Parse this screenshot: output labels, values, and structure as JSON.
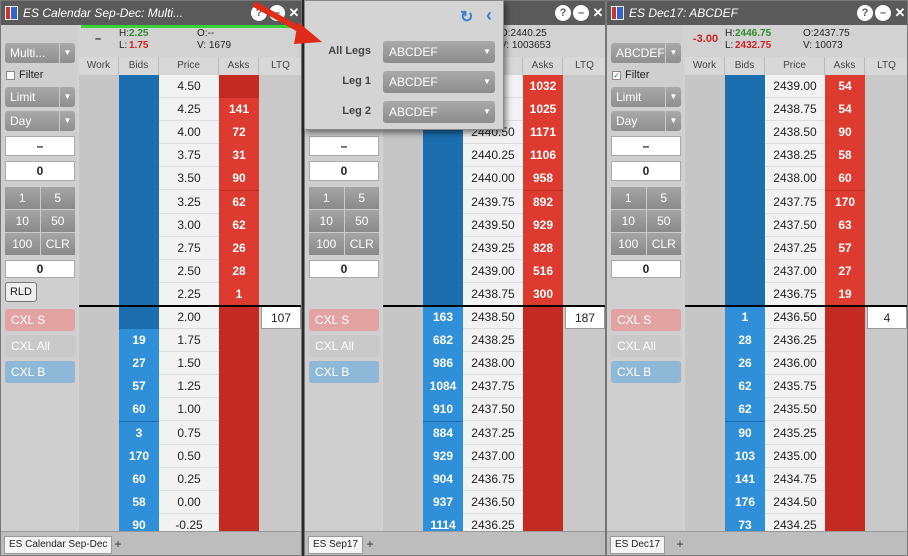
{
  "windows": [
    {
      "title": "ES Calendar Sep-Dec: Multi...",
      "header": {
        "net": "–",
        "high_label": "H:",
        "high": "2.25",
        "low_label": "L:",
        "low": "1.75",
        "open": "O:--",
        "volume": "V: 1679"
      },
      "side": {
        "account": "Multi...",
        "filter": "Filter",
        "filter_checked": false,
        "order_type": "Limit",
        "tif": "Day",
        "price": "–",
        "qty": "0",
        "qty_buttons": [
          "1",
          "5",
          "10",
          "50",
          "100",
          "CLR"
        ],
        "pos": "0",
        "rld": "RLD",
        "cxl_s": "CXL S",
        "cxl_all": "CXL All",
        "cxl_b": "CXL B"
      },
      "columns": [
        "Work",
        "Bids",
        "Price",
        "Asks",
        "LTQ"
      ],
      "rows": [
        {
          "bid": "",
          "price": "4.50",
          "ask": ""
        },
        {
          "bid": "",
          "price": "4.25",
          "ask": "141"
        },
        {
          "bid": "",
          "price": "4.00",
          "ask": "72"
        },
        {
          "bid": "",
          "price": "3.75",
          "ask": "31"
        },
        {
          "bid": "",
          "price": "3.50",
          "ask": "90"
        },
        {
          "bid": "",
          "price": "3.25",
          "ask": "62"
        },
        {
          "bid": "",
          "price": "3.00",
          "ask": "62"
        },
        {
          "bid": "",
          "price": "2.75",
          "ask": "26"
        },
        {
          "bid": "",
          "price": "2.50",
          "ask": "28"
        },
        {
          "bid": "",
          "price": "2.25",
          "ask": "1"
        },
        {
          "bid": "",
          "price": "2.00",
          "ask": "",
          "ltq": "107"
        },
        {
          "bid": "19",
          "price": "1.75",
          "ask": ""
        },
        {
          "bid": "27",
          "price": "1.50",
          "ask": ""
        },
        {
          "bid": "57",
          "price": "1.25",
          "ask": ""
        },
        {
          "bid": "60",
          "price": "1.00",
          "ask": ""
        },
        {
          "bid": "3",
          "price": "0.75",
          "ask": ""
        },
        {
          "bid": "170",
          "price": "0.50",
          "ask": ""
        },
        {
          "bid": "60",
          "price": "0.25",
          "ask": ""
        },
        {
          "bid": "58",
          "price": "0.00",
          "ask": ""
        },
        {
          "bid": "90",
          "price": "-0.25",
          "ask": ""
        }
      ],
      "tab": "ES Calendar Sep-Dec"
    },
    {
      "title": "",
      "header": {
        "net": "",
        "high_label": "",
        "high": "",
        "low_label": "",
        "low": "",
        "open": "O:2440.25",
        "volume": "V: 1003653"
      },
      "side": {
        "account": "",
        "filter": "",
        "filter_checked": false,
        "order_type": "",
        "tif": "",
        "price": "–",
        "qty": "0",
        "qty_buttons": [
          "1",
          "5",
          "10",
          "50",
          "100",
          "CLR"
        ],
        "pos": "0",
        "rld": "",
        "cxl_s": "CXL S",
        "cxl_all": "CXL All",
        "cxl_b": "CXL B"
      },
      "columns": [
        "Work",
        "Bids",
        "Price",
        "Asks",
        "LTQ"
      ],
      "rows": [
        {
          "bid": "",
          "price": "",
          "ask": "1032"
        },
        {
          "bid": "",
          "price": "",
          "ask": "1025"
        },
        {
          "bid": "",
          "price": "2440.50",
          "ask": "1171"
        },
        {
          "bid": "",
          "price": "2440.25",
          "ask": "1106"
        },
        {
          "bid": "",
          "price": "2440.00",
          "ask": "958"
        },
        {
          "bid": "",
          "price": "2439.75",
          "ask": "892"
        },
        {
          "bid": "",
          "price": "2439.50",
          "ask": "929"
        },
        {
          "bid": "",
          "price": "2439.25",
          "ask": "828"
        },
        {
          "bid": "",
          "price": "2439.00",
          "ask": "516"
        },
        {
          "bid": "",
          "price": "2438.75",
          "ask": "300"
        },
        {
          "bid": "163",
          "price": "2438.50",
          "ask": "",
          "ltq": "187"
        },
        {
          "bid": "682",
          "price": "2438.25",
          "ask": ""
        },
        {
          "bid": "986",
          "price": "2438.00",
          "ask": ""
        },
        {
          "bid": "1084",
          "price": "2437.75",
          "ask": ""
        },
        {
          "bid": "910",
          "price": "2437.50",
          "ask": ""
        },
        {
          "bid": "884",
          "price": "2437.25",
          "ask": ""
        },
        {
          "bid": "929",
          "price": "2437.00",
          "ask": ""
        },
        {
          "bid": "904",
          "price": "2436.75",
          "ask": ""
        },
        {
          "bid": "937",
          "price": "2436.50",
          "ask": ""
        },
        {
          "bid": "1114",
          "price": "2436.25",
          "ask": ""
        }
      ],
      "tab": "ES Sep17"
    },
    {
      "title": "ES Dec17: ABCDEF",
      "header": {
        "net": "-3.00",
        "high_label": "H:",
        "high": "2446.75",
        "low_label": "L:",
        "low": "2432.75",
        "open": "O:2437.75",
        "volume": "V: 10073"
      },
      "side": {
        "account": "ABCDEF",
        "filter": "Filter",
        "filter_checked": true,
        "order_type": "Limit",
        "tif": "Day",
        "price": "–",
        "qty": "0",
        "qty_buttons": [
          "1",
          "5",
          "10",
          "50",
          "100",
          "CLR"
        ],
        "pos": "0",
        "rld": "",
        "cxl_s": "CXL S",
        "cxl_all": "CXL All",
        "cxl_b": "CXL B"
      },
      "columns": [
        "Work",
        "Bids",
        "Price",
        "Asks",
        "LTQ"
      ],
      "rows": [
        {
          "bid": "",
          "price": "2439.00",
          "ask": "54"
        },
        {
          "bid": "",
          "price": "2438.75",
          "ask": "54"
        },
        {
          "bid": "",
          "price": "2438.50",
          "ask": "90"
        },
        {
          "bid": "",
          "price": "2438.25",
          "ask": "58"
        },
        {
          "bid": "",
          "price": "2438.00",
          "ask": "60"
        },
        {
          "bid": "",
          "price": "2437.75",
          "ask": "170"
        },
        {
          "bid": "",
          "price": "2437.50",
          "ask": "63"
        },
        {
          "bid": "",
          "price": "2437.25",
          "ask": "57"
        },
        {
          "bid": "",
          "price": "2437.00",
          "ask": "27"
        },
        {
          "bid": "",
          "price": "2436.75",
          "ask": "19"
        },
        {
          "bid": "1",
          "price": "2436.50",
          "ask": "",
          "ltq": "4"
        },
        {
          "bid": "28",
          "price": "2436.25",
          "ask": ""
        },
        {
          "bid": "26",
          "price": "2436.00",
          "ask": ""
        },
        {
          "bid": "62",
          "price": "2435.75",
          "ask": ""
        },
        {
          "bid": "62",
          "price": "2435.50",
          "ask": ""
        },
        {
          "bid": "90",
          "price": "2435.25",
          "ask": ""
        },
        {
          "bid": "103",
          "price": "2435.00",
          "ask": ""
        },
        {
          "bid": "141",
          "price": "2434.75",
          "ask": ""
        },
        {
          "bid": "176",
          "price": "2434.50",
          "ask": ""
        },
        {
          "bid": "73",
          "price": "2434.25",
          "ask": ""
        }
      ],
      "tab": "ES Dec17"
    }
  ],
  "popup": {
    "legs": [
      {
        "label": "All Legs",
        "value": "ABCDEF"
      },
      {
        "label": "Leg 1",
        "value": "ABCDEF"
      },
      {
        "label": "Leg 2",
        "value": "ABCDEF"
      }
    ]
  },
  "icons": {
    "help": "help-icon",
    "minimize": "minimize-icon",
    "close": "close-icon",
    "refresh": "refresh-icon",
    "collapse": "chevron-left-icon",
    "add_tab": "plus-icon",
    "arrow": "red-arrow-icon"
  },
  "colors": {
    "bid": "#1b6fb0",
    "ask": "#c52a22",
    "high": "#2e8b2e",
    "low": "#cc2222",
    "cxl_sell": "#e3a3a3",
    "cxl_buy": "#8fb8d6"
  }
}
